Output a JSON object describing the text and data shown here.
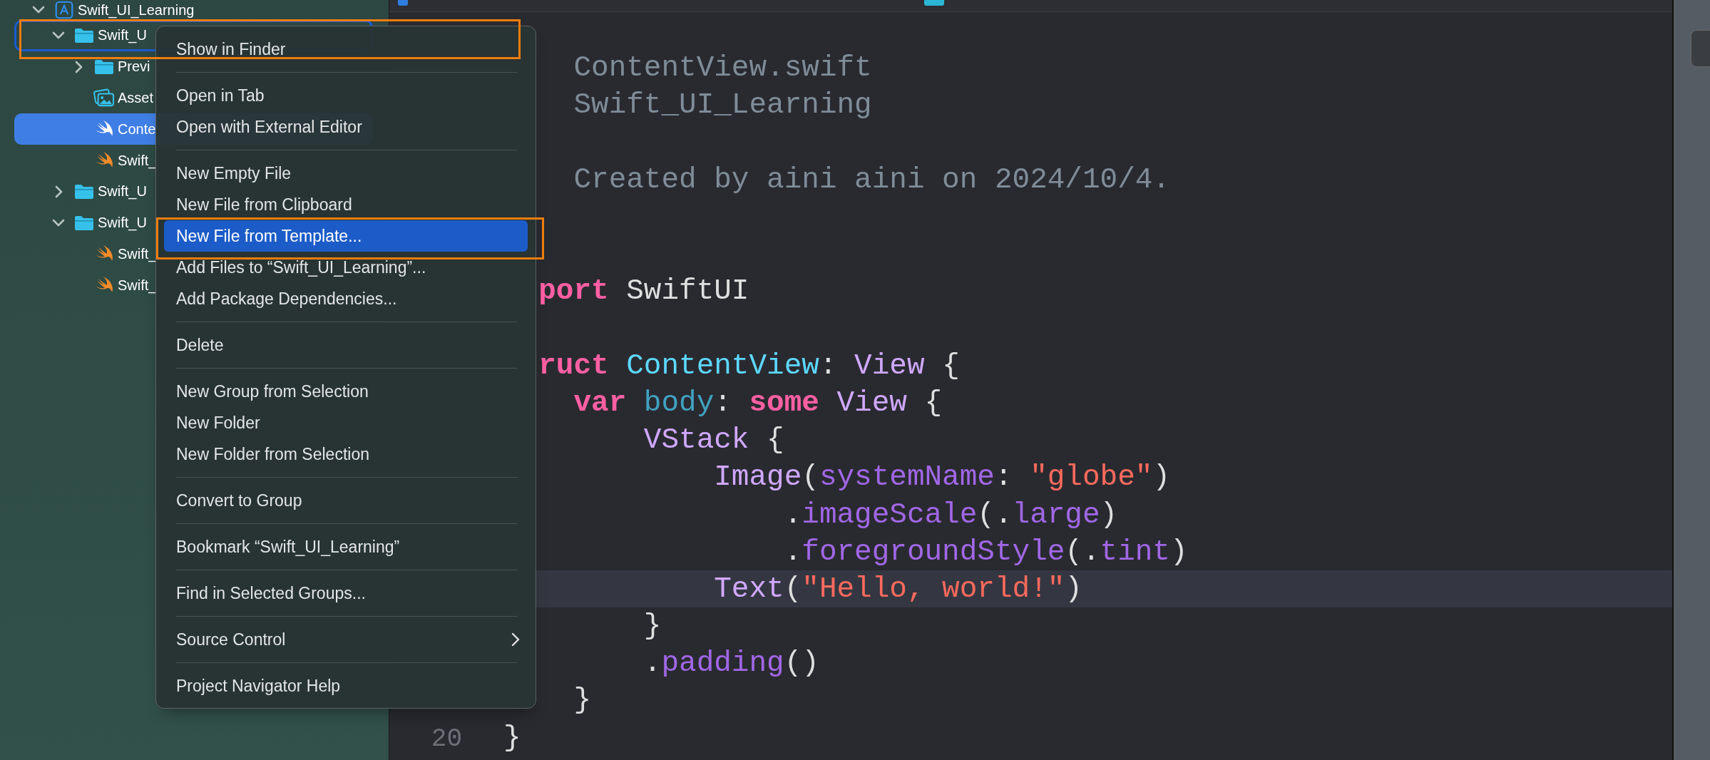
{
  "navigator": {
    "items": [
      {
        "label": "Swift_UI_Learning",
        "kind": "project",
        "expanded": true,
        "selected": false,
        "focused": false,
        "children": [
          {
            "label": "Swift_U",
            "kind": "folder",
            "expanded": true,
            "selected": false,
            "focused": true,
            "children": [
              {
                "label": "Previ",
                "kind": "folder",
                "expanded": false,
                "selected": false,
                "focused": false
              },
              {
                "label": "Asset",
                "kind": "assets",
                "selected": false,
                "focused": false
              },
              {
                "label": "Conte",
                "kind": "swift",
                "selected": true,
                "focused": false
              },
              {
                "label": "Swift_",
                "kind": "swift",
                "selected": false,
                "focused": false
              }
            ]
          },
          {
            "label": "Swift_U",
            "kind": "folder",
            "expanded": false,
            "selected": false,
            "focused": false
          },
          {
            "label": "Swift_U",
            "kind": "folder",
            "expanded": true,
            "selected": false,
            "focused": false,
            "children": [
              {
                "label": "Swift_",
                "kind": "swift",
                "selected": false,
                "focused": false
              },
              {
                "label": "Swift_",
                "kind": "swift",
                "selected": false,
                "focused": false
              }
            ]
          }
        ]
      }
    ]
  },
  "editor": {
    "lines": [
      {
        "kind": "blank",
        "current": false
      },
      {
        "kind": "code",
        "current": false,
        "segments": [
          {
            "text": "    ContentView.swift",
            "kind": "comment"
          }
        ]
      },
      {
        "kind": "code",
        "current": false,
        "segments": [
          {
            "text": "    Swift_UI_Learning",
            "kind": "comment"
          }
        ]
      },
      {
        "kind": "blank",
        "current": false
      },
      {
        "kind": "code",
        "current": false,
        "segments": [
          {
            "text": "    Created by aini aini on 2024/10/4.",
            "kind": "comment"
          }
        ]
      },
      {
        "kind": "blank",
        "current": false
      },
      {
        "kind": "blank",
        "current": false
      },
      {
        "kind": "code",
        "current": false,
        "segments": [
          {
            "text": "  port",
            "kind": "keyword"
          },
          {
            "text": " SwiftUI",
            "kind": "plain"
          }
        ]
      },
      {
        "kind": "blank",
        "current": false
      },
      {
        "kind": "code",
        "current": false,
        "segments": [
          {
            "text": "  ruct",
            "kind": "keyword"
          },
          {
            "text": " ContentView",
            "kind": "type-decl"
          },
          {
            "text": ": ",
            "kind": "plain"
          },
          {
            "text": "View",
            "kind": "type"
          },
          {
            "text": " {",
            "kind": "plain"
          }
        ]
      },
      {
        "kind": "code",
        "current": false,
        "segments": [
          {
            "text": "    var",
            "kind": "keyword"
          },
          {
            "text": " body",
            "kind": "property-decl"
          },
          {
            "text": ": ",
            "kind": "plain"
          },
          {
            "text": "some",
            "kind": "keyword"
          },
          {
            "text": " View",
            "kind": "type"
          },
          {
            "text": " {",
            "kind": "plain"
          }
        ]
      },
      {
        "kind": "code",
        "current": false,
        "segments": [
          {
            "text": "        VStack",
            "kind": "type"
          },
          {
            "text": " {",
            "kind": "plain"
          }
        ]
      },
      {
        "kind": "code",
        "current": false,
        "segments": [
          {
            "text": "            Image",
            "kind": "type"
          },
          {
            "text": "(",
            "kind": "plain"
          },
          {
            "text": "systemName",
            "kind": "method"
          },
          {
            "text": ": ",
            "kind": "plain"
          },
          {
            "text": "\"globe\"",
            "kind": "string"
          },
          {
            "text": ")",
            "kind": "plain"
          }
        ]
      },
      {
        "kind": "code",
        "current": false,
        "segments": [
          {
            "text": "                .",
            "kind": "plain"
          },
          {
            "text": "imageScale",
            "kind": "method"
          },
          {
            "text": "(.",
            "kind": "plain"
          },
          {
            "text": "large",
            "kind": "method"
          },
          {
            "text": ")",
            "kind": "plain"
          }
        ]
      },
      {
        "kind": "code",
        "current": false,
        "segments": [
          {
            "text": "                .",
            "kind": "plain"
          },
          {
            "text": "foregroundStyle",
            "kind": "method"
          },
          {
            "text": "(.",
            "kind": "plain"
          },
          {
            "text": "tint",
            "kind": "method"
          },
          {
            "text": ")",
            "kind": "plain"
          }
        ]
      },
      {
        "kind": "code",
        "current": true,
        "segments": [
          {
            "text": "            Text",
            "kind": "type"
          },
          {
            "text": "(",
            "kind": "plain"
          },
          {
            "text": "\"Hello, world!\"",
            "kind": "string"
          },
          {
            "text": ")",
            "kind": "plain"
          }
        ]
      },
      {
        "kind": "code",
        "current": false,
        "segments": [
          {
            "text": "        }",
            "kind": "plain"
          }
        ]
      },
      {
        "kind": "code",
        "current": false,
        "segments": [
          {
            "text": "        .",
            "kind": "plain"
          },
          {
            "text": "padding",
            "kind": "method"
          },
          {
            "text": "()",
            "kind": "plain"
          }
        ]
      },
      {
        "kind": "code",
        "current": false,
        "segments": [
          {
            "text": "    }",
            "kind": "plain"
          }
        ]
      },
      {
        "kind": "code",
        "number": "20",
        "current": false,
        "segments": [
          {
            "text": "}",
            "kind": "plain"
          }
        ]
      }
    ]
  },
  "context_menu": {
    "items": [
      {
        "kind": "item",
        "label": "Show in Finder",
        "selected": false,
        "framed": true
      },
      {
        "kind": "separator"
      },
      {
        "kind": "item",
        "label": "Open in Tab",
        "selected": false,
        "framed": false
      },
      {
        "kind": "item",
        "label": "Open with External Editor",
        "selected": false,
        "framed": false
      },
      {
        "kind": "separator"
      },
      {
        "kind": "item",
        "label": "New Empty File",
        "selected": false,
        "framed": false
      },
      {
        "kind": "item",
        "label": "New File from Clipboard",
        "selected": false,
        "framed": false
      },
      {
        "kind": "item",
        "label": "New File from Template...",
        "selected": true,
        "framed": true
      },
      {
        "kind": "item",
        "label": "Add Files to “Swift_UI_Learning”...",
        "selected": false,
        "framed": false
      },
      {
        "kind": "item",
        "label": "Add Package Dependencies...",
        "selected": false,
        "framed": false
      },
      {
        "kind": "separator"
      },
      {
        "kind": "item",
        "label": "Delete",
        "selected": false,
        "framed": false
      },
      {
        "kind": "separator"
      },
      {
        "kind": "item",
        "label": "New Group from Selection",
        "selected": false,
        "framed": false
      },
      {
        "kind": "item",
        "label": "New Folder",
        "selected": false,
        "framed": false
      },
      {
        "kind": "item",
        "label": "New Folder from Selection",
        "selected": false,
        "framed": false
      },
      {
        "kind": "separator"
      },
      {
        "kind": "item",
        "label": "Convert to Group",
        "selected": false,
        "framed": false
      },
      {
        "kind": "separator"
      },
      {
        "kind": "item",
        "label": "Bookmark “Swift_UI_Learning”",
        "selected": false,
        "framed": false
      },
      {
        "kind": "separator"
      },
      {
        "kind": "item",
        "label": "Find in Selected Groups...",
        "selected": false,
        "framed": false
      },
      {
        "kind": "separator"
      },
      {
        "kind": "submenu",
        "label": "Source Control",
        "selected": false,
        "framed": false
      },
      {
        "kind": "separator"
      },
      {
        "kind": "item",
        "label": "Project Navigator Help",
        "selected": false,
        "framed": false
      }
    ]
  }
}
